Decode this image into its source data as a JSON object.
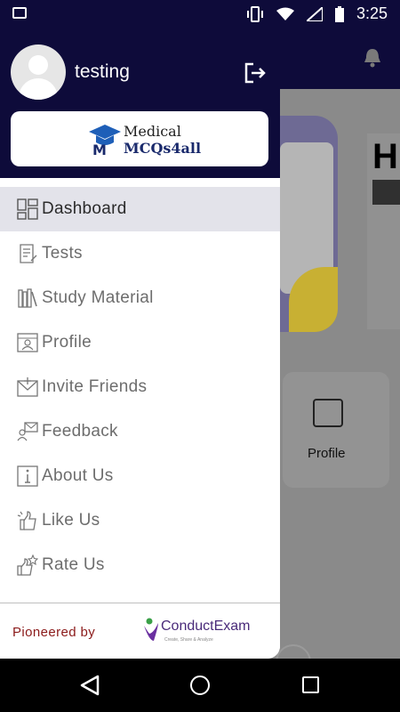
{
  "status_bar": {
    "time": "3:25",
    "icons": [
      "image-icon",
      "vibrate-icon",
      "wifi-icon",
      "signal-icon",
      "battery-icon"
    ]
  },
  "background_screen": {
    "card_label": "Profile",
    "banner_letter": "H"
  },
  "drawer": {
    "username": "testing",
    "logo": {
      "line1": "Medical",
      "line2": "MCQs4all"
    },
    "menu": [
      {
        "label": "Dashboard",
        "icon": "dashboard-icon",
        "active": true
      },
      {
        "label": "Tests",
        "icon": "tests-icon",
        "active": false
      },
      {
        "label": "Study Material",
        "icon": "books-icon",
        "active": false
      },
      {
        "label": "Profile",
        "icon": "profile-icon",
        "active": false
      },
      {
        "label": "Invite Friends",
        "icon": "invite-icon",
        "active": false
      },
      {
        "label": "Feedback",
        "icon": "feedback-icon",
        "active": false
      },
      {
        "label": "About Us",
        "icon": "info-icon",
        "active": false
      },
      {
        "label": "Like Us",
        "icon": "like-icon",
        "active": false
      },
      {
        "label": "Rate Us",
        "icon": "rate-icon",
        "active": false
      }
    ],
    "footer": {
      "pioneered_by": "Pioneered by",
      "brand": "ConductExam",
      "tagline": "Create, Share & Analyze"
    }
  },
  "nav_bar": {
    "buttons": [
      "back-button",
      "home-button",
      "recents-button"
    ]
  },
  "colors": {
    "header": "#0e0b3a",
    "active_row": "#e3e3ea",
    "accent": "#8b1a1a",
    "brand_purple": "#4a2b7a"
  }
}
